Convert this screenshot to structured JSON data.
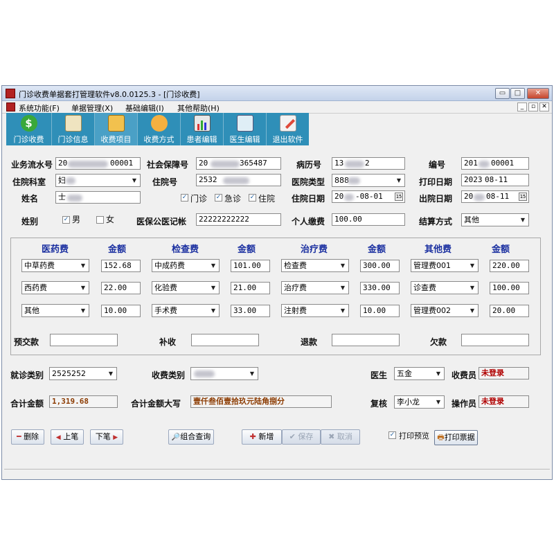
{
  "window": {
    "title": "门诊收费单据套打管理软件v8.0.0125.3 - [门诊收费]",
    "title_buttons": [
      "▭",
      "□",
      "✕"
    ],
    "mdi_buttons": [
      "_",
      "▫",
      "✕"
    ]
  },
  "menu": [
    "系统功能(F)",
    "单据管理(X)",
    "基础编辑(I)",
    "其他帮助(H)"
  ],
  "toolbar": [
    {
      "label": "门诊收费",
      "icon": "dollar-icon",
      "color": "#3aa83a"
    },
    {
      "label": "门诊信息",
      "icon": "document-icon",
      "color": "#e8d9a8"
    },
    {
      "label": "收费项目",
      "icon": "people-icon",
      "color": "#f2c14e"
    },
    {
      "label": "收费方式",
      "icon": "person-icon",
      "color": "#f5b040"
    },
    {
      "label": "患者编辑",
      "icon": "chart-icon",
      "color": "#e0e0e0"
    },
    {
      "label": "医生编辑",
      "icon": "id-card-icon",
      "color": "#d8e8f0"
    },
    {
      "label": "退出软件",
      "icon": "pencil-icon",
      "color": "#e04a3a"
    }
  ],
  "form": {
    "serial_label": "业务流水号",
    "serial_value": "20",
    "serial_suffix": "00001",
    "social_label": "社会保障号",
    "social_value": "20",
    "social_suffix": "365487",
    "record_label": "病历号",
    "record_value": "13",
    "record_suffix": "2",
    "no_label": "编号",
    "no_value": "201",
    "no_suffix": "00001",
    "dept_label": "住院科室",
    "dept_value": "妇",
    "bed_label": "住院号",
    "bed_value": "2532",
    "hospital_type_label": "医院类型",
    "hospital_type_value": "888",
    "print_date_label": "打印日期",
    "print_date_value": "2023",
    "print_date_suffix": "08-11",
    "name_label": "姓名",
    "name_value": "士",
    "visit_outpatient": "门诊",
    "visit_emergency": "急诊",
    "visit_inpatient": "住院",
    "admit_date_label": "住院日期",
    "admit_date_value": "20",
    "admit_date_suffix": "-08-01",
    "discharge_date_label": "出院日期",
    "discharge_date_value": "20",
    "discharge_date_suffix": "08-11",
    "gender_label": "姓别",
    "gender_male": "男",
    "gender_female": "女",
    "insurance_label": "医保公医记帐",
    "insurance_value": "22222222222",
    "self_pay_label": "个人缴费",
    "self_pay_value": "100.00",
    "settle_label": "结算方式",
    "settle_value": "其他"
  },
  "fees": {
    "headers": [
      "医药费",
      "金额",
      "检查费",
      "金额",
      "治疗费",
      "金额",
      "其他费",
      "金额"
    ],
    "rows": [
      [
        {
          "item": "中草药费",
          "amount": "152.68"
        },
        {
          "item": "中成药费",
          "amount": "101.00"
        },
        {
          "item": "检查费",
          "amount": "300.00"
        },
        {
          "item": "管理费001",
          "amount": "220.00"
        }
      ],
      [
        {
          "item": "西药费",
          "amount": "22.00"
        },
        {
          "item": "化验费",
          "amount": "21.00"
        },
        {
          "item": "治疗费",
          "amount": "330.00"
        },
        {
          "item": "诊查费",
          "amount": "100.00"
        }
      ],
      [
        {
          "item": "其他",
          "amount": "10.00"
        },
        {
          "item": "手术费",
          "amount": "33.00"
        },
        {
          "item": "注射费",
          "amount": "10.00"
        },
        {
          "item": "管理费002",
          "amount": "20.00"
        }
      ]
    ],
    "prepay_label": "预交款",
    "supplement_label": "补收",
    "refund_label": "退款",
    "owed_label": "欠款"
  },
  "bottom": {
    "visit_type_label": "就诊类别",
    "visit_type_value": "2525252",
    "charge_type_label": "收费类别",
    "doctor_label": "医生",
    "doctor_value": "五金",
    "cashier_label": "收费员",
    "cashier_value": "未登录",
    "total_label": "合计金额",
    "total_value": "1,319.68",
    "total_upper_label": "合计金额大写",
    "total_upper_value": "壹仟叁佰壹拾玖元陆角捌分",
    "review_label": "复核",
    "review_value": "李小龙",
    "operator_label": "操作员",
    "operator_value": "未登录"
  },
  "actions": {
    "delete": "删除",
    "prev": "上笔",
    "next": "下笔",
    "combo_query": "组合查询",
    "add": "新增",
    "save": "保存",
    "cancel": "取消",
    "print_preview": "打印预览",
    "print": "打印票据"
  },
  "glyphs": {
    "dropdown": "▼",
    "calendar": "15",
    "check": "✓",
    "minus": "━",
    "prev": "◀",
    "next": "▶",
    "search": "🔎",
    "plus": "✚",
    "save": "✔",
    "cancel": "✖",
    "printer": "🖶",
    "dollar": "$"
  }
}
